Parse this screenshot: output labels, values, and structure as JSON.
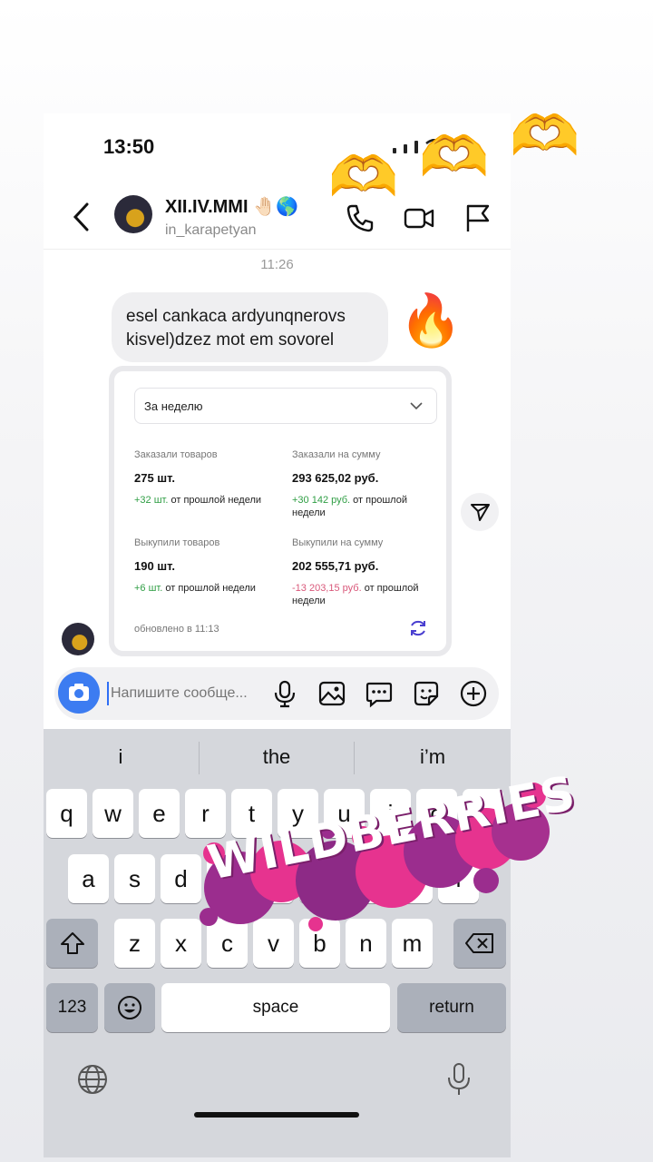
{
  "status": {
    "time": "13:50"
  },
  "header": {
    "name": "XII.IV.MMI",
    "name_emoji": "🤚🏻🌎",
    "handle": "in_karapetyan"
  },
  "chat": {
    "time_separator": "11:26",
    "message_line1": "esel cankaca ardyunqnerovs",
    "message_line2": "kisvel)dzez mot em sovorel",
    "reaction_emoji": "🔥"
  },
  "stats_card": {
    "period": "За неделю",
    "ordered_qty_label": "Заказали товаров",
    "ordered_qty_value": "275 шт.",
    "ordered_qty_change": "+32 шт.",
    "ordered_qty_change_suffix": "от прошлой недели",
    "ordered_sum_label": "Заказали на сумму",
    "ordered_sum_value": "293 625,02 руб.",
    "ordered_sum_change": "+30 142 руб.",
    "ordered_sum_change_suffix": "от прошлой недели",
    "bought_qty_label": "Выкупили товаров",
    "bought_qty_value": "190 шт.",
    "bought_qty_change": "+6 шт.",
    "bought_qty_change_suffix": "от прошлой недели",
    "bought_sum_label": "Выкупили на сумму",
    "bought_sum_value": "202 555,71 руб.",
    "bought_sum_change": "-13 203,15 руб.",
    "bought_sum_change_suffix": "от прошлой недели",
    "updated": "обновлено в 11:13"
  },
  "composer": {
    "placeholder": "Напишите сообще..."
  },
  "keyboard": {
    "suggestions": [
      "i",
      "the",
      "i’m"
    ],
    "row1": [
      "q",
      "w",
      "e",
      "r",
      "t",
      "y",
      "u",
      "i",
      "o",
      "p"
    ],
    "row2": [
      "a",
      "s",
      "d",
      "f",
      "g",
      "h",
      "j",
      "k",
      "l"
    ],
    "row3": [
      "z",
      "x",
      "c",
      "v",
      "b",
      "n",
      "m"
    ],
    "numbers_key": "123",
    "space_key": "space",
    "return_key": "return"
  },
  "sticker": {
    "text": "WILDBERRIES"
  },
  "decor": {
    "hand_heart": "🫶"
  },
  "colors": {
    "accent": "#3c7cf1",
    "positive": "#2f9e44",
    "negative": "#d9587a",
    "wb_pink": "#e6338f",
    "wb_purple": "#9b2d8e"
  }
}
